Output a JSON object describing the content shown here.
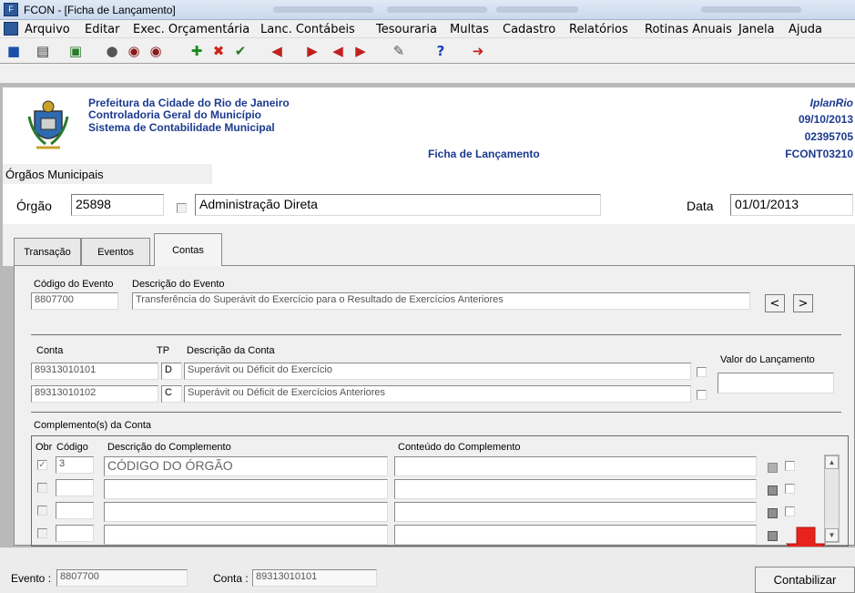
{
  "window": {
    "title": "FCON - [Ficha de Lançamento]",
    "app_icon": "app-icon"
  },
  "menu": [
    "Arquivo",
    "Editar",
    "Exec. Orçamentária",
    "Lanc. Contábeis",
    "Tesouraria",
    "Multas",
    "Cadastro",
    "Relatórios",
    "Rotinas Anuais",
    "Janela",
    "Ajuda"
  ],
  "header": {
    "org_line1": "Prefeitura da Cidade do Rio de Janeiro",
    "org_line2": "Controladoria Geral do Município",
    "org_line3": "Sistema de Contabilidade Municipal",
    "form_title": "Ficha de Lançamento",
    "right_line1": "IplanRio",
    "right_line2": "09/10/2013",
    "right_line3": "02395705",
    "right_line4": "FCONT03210"
  },
  "orgaos": {
    "section_label": "Órgãos Municipais",
    "orgao_label": "Órgão",
    "orgao_value": "25898",
    "orgao_desc": "Administração Direta",
    "data_label": "Data",
    "data_value": "01/01/2013"
  },
  "tabs": [
    "Transação",
    "Eventos",
    "Contas"
  ],
  "evento": {
    "codigo_label": "Código do Evento",
    "descricao_label": "Descrição do Evento",
    "codigo_value": "8807700",
    "descricao_value": "Transferência do Superávit do Exercício para o Resultado de Exercícios Anteriores",
    "prev": "<",
    "next": ">"
  },
  "contas": {
    "conta_label": "Conta",
    "tp_label": "TP",
    "descricao_label": "Descrição da Conta",
    "valor_label": "Valor do Lançamento",
    "rows": [
      {
        "conta": "89313010101",
        "tp": "D",
        "descricao": "Superávit ou Déficit do Exercício"
      },
      {
        "conta": "89313010102",
        "tp": "C",
        "descricao": "Superávit ou Déficit de Exercícios Anteriores"
      }
    ]
  },
  "complementos": {
    "section_label": "Complemento(s) da Conta",
    "obr_label": "Obr",
    "codigo_label": "Código",
    "descricao_label": "Descrição do Complemento",
    "conteudo_label": "Conteúdo do Complemento",
    "rows": [
      {
        "codigo": "3",
        "descricao": "CÓDIGO DO ÓRGÃO",
        "conteudo": ""
      },
      {
        "codigo": "",
        "descricao": "",
        "conteudo": ""
      },
      {
        "codigo": "",
        "descricao": "",
        "conteudo": ""
      },
      {
        "codigo": "",
        "descricao": "",
        "conteudo": ""
      }
    ]
  },
  "footer": {
    "evento_label": "Evento :",
    "evento_value": "8807700",
    "conta_label": "Conta :",
    "conta_value": "89313010101",
    "contabilizar": "Contabilizar"
  },
  "colors": {
    "header_blue": "#1b3a8f",
    "arrow_red": "#e8231d"
  }
}
